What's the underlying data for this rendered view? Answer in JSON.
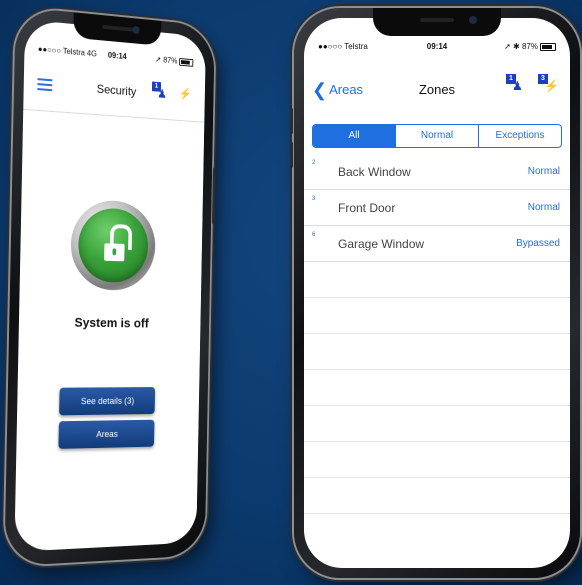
{
  "left_phone": {
    "status": {
      "carrier": "●●○○○ Telstra 4G",
      "time": "09:14",
      "battery": "87%"
    },
    "nav": {
      "title": "Security",
      "notification_count": "1",
      "action_icon": "flash-icon"
    },
    "state_text": "System is off",
    "buttons": {
      "details": "See details (3)",
      "areas": "Areas"
    }
  },
  "right_phone": {
    "status": {
      "carrier": "●●○○○ Telstra",
      "time": "09:14",
      "battery": "87%"
    },
    "nav": {
      "back_label": "Areas",
      "title": "Zones",
      "notification_count": "1",
      "alert_count": "3"
    },
    "segments": [
      "All",
      "Normal",
      "Exceptions"
    ],
    "zones": [
      {
        "index": "2",
        "name": "Back Window",
        "state": "Normal"
      },
      {
        "index": "3",
        "name": "Front Door",
        "state": "Normal"
      },
      {
        "index": "6",
        "name": "Garage Window",
        "state": "Bypassed"
      }
    ]
  },
  "colors": {
    "accent": "#1f6fe0",
    "lock_green": "#3aa23a",
    "button_blue": "#1a4a92",
    "background": "#0b3a6e"
  }
}
